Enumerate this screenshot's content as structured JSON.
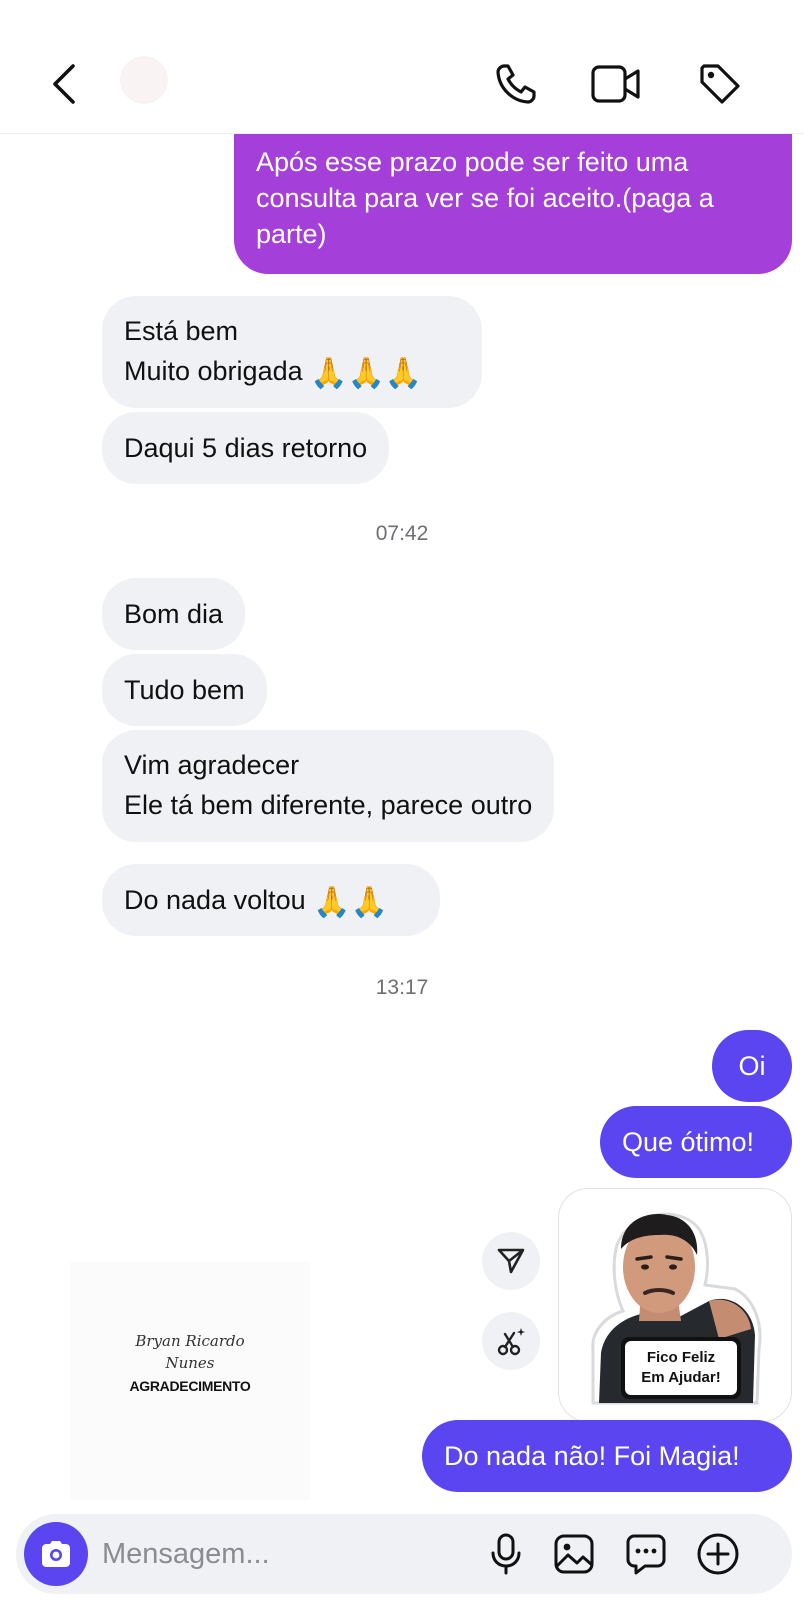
{
  "header": {
    "back_icon": "chevron-left-icon",
    "call_icon": "phone-icon",
    "video_icon": "video-camera-icon",
    "tag_icon": "tag-icon"
  },
  "messages": {
    "sent_top": "Após esse prazo pode ser feito uma consulta para ver se foi aceito.(paga a parte)",
    "recv_1_line1": "Está bem",
    "recv_1_line2": "Muito obrigada",
    "recv_2": "Daqui 5 dias retorno",
    "time_1": "07:42",
    "recv_3": "Bom dia",
    "recv_4": "Tudo bem",
    "recv_5_line1": "Vim agradecer",
    "recv_5_line2": "Ele tá bem diferente, parece outro",
    "recv_6": "Do nada voltou",
    "time_2": "13:17",
    "sent_1": "Oi",
    "sent_2": "Que ótimo!",
    "sent_3": "Do nada não! Foi Magia!",
    "sticker_text_1": "Fico Feliz",
    "sticker_text_2": "Em Ajudar!",
    "pray_emoji": "🙏"
  },
  "watermark": {
    "script_line1": "Bryan Ricardo",
    "script_line2": "Nunes",
    "label": "AGRADECIMENTO"
  },
  "composer": {
    "placeholder": "Mensagem...",
    "icons": [
      "camera-icon",
      "microphone-icon",
      "gallery-icon",
      "sticker-chat-icon",
      "plus-icon"
    ]
  },
  "colors": {
    "sent_bubble": "#5a45f0",
    "sent_purple_bubble": "#a53fd9",
    "received_bubble": "#eff1f4"
  }
}
